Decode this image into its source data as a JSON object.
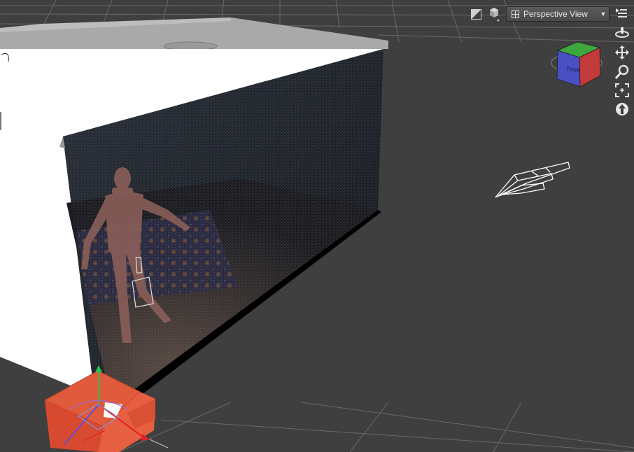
{
  "viewport": {
    "view_selector": {
      "label": "Perspective View",
      "options_visible": [
        "Perspective View"
      ]
    },
    "view_cube": {
      "face_front": "Front",
      "colors": {
        "front": "#4a4fc2",
        "top": "#3ea83e",
        "right": "#c23a3a"
      }
    },
    "toolbar_icons": [
      "draw-style-icon",
      "camera-menu-icon",
      "view-grid-icon",
      "viewport-menu-icon"
    ],
    "nav_icons": [
      "orbit-icon",
      "pan-icon",
      "zoom-icon",
      "frame-icon",
      "reset-view-icon"
    ],
    "colors": {
      "background": "#3f3f3f",
      "grid_line": "#8c8c8c",
      "wall_white": "#ffffff",
      "render_dark": "#1b1e24",
      "gizmo_orange": "#e05a3c"
    }
  }
}
